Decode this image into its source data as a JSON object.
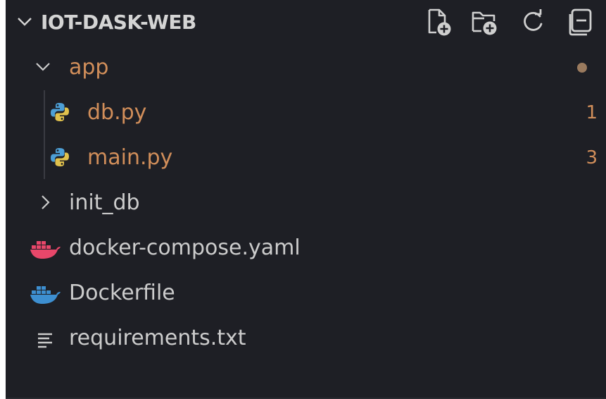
{
  "header": {
    "title": "IOT-DASK-WEB",
    "actions": [
      {
        "name": "new-file-icon",
        "label": "New File"
      },
      {
        "name": "new-folder-icon",
        "label": "New Folder"
      },
      {
        "name": "refresh-icon",
        "label": "Refresh Explorer"
      },
      {
        "name": "collapse-all-icon",
        "label": "Collapse Folders"
      }
    ]
  },
  "tree": {
    "folder_app": {
      "label": "app",
      "expanded": true,
      "modified_dot": true
    },
    "file_db": {
      "label": "db.py",
      "badge": "1",
      "icon": "python-icon"
    },
    "file_main": {
      "label": "main.py",
      "badge": "3",
      "icon": "python-icon"
    },
    "folder_init_db": {
      "label": "init_db",
      "expanded": false
    },
    "file_compose": {
      "label": "docker-compose.yaml",
      "icon": "docker-icon"
    },
    "file_dockerfile": {
      "label": "Dockerfile",
      "icon": "docker-icon"
    },
    "file_requirements": {
      "label": "requirements.txt",
      "icon": "text-lines-icon"
    }
  },
  "colors": {
    "background": "#1e1f25",
    "text": "#cccccc",
    "modified": "#d18e5a",
    "badge": "#d18e5a",
    "python_blue": "#4d9fd6",
    "python_yellow": "#e0c14d",
    "docker_compose": "#e8476a",
    "docker_file": "#3d8fd1"
  }
}
